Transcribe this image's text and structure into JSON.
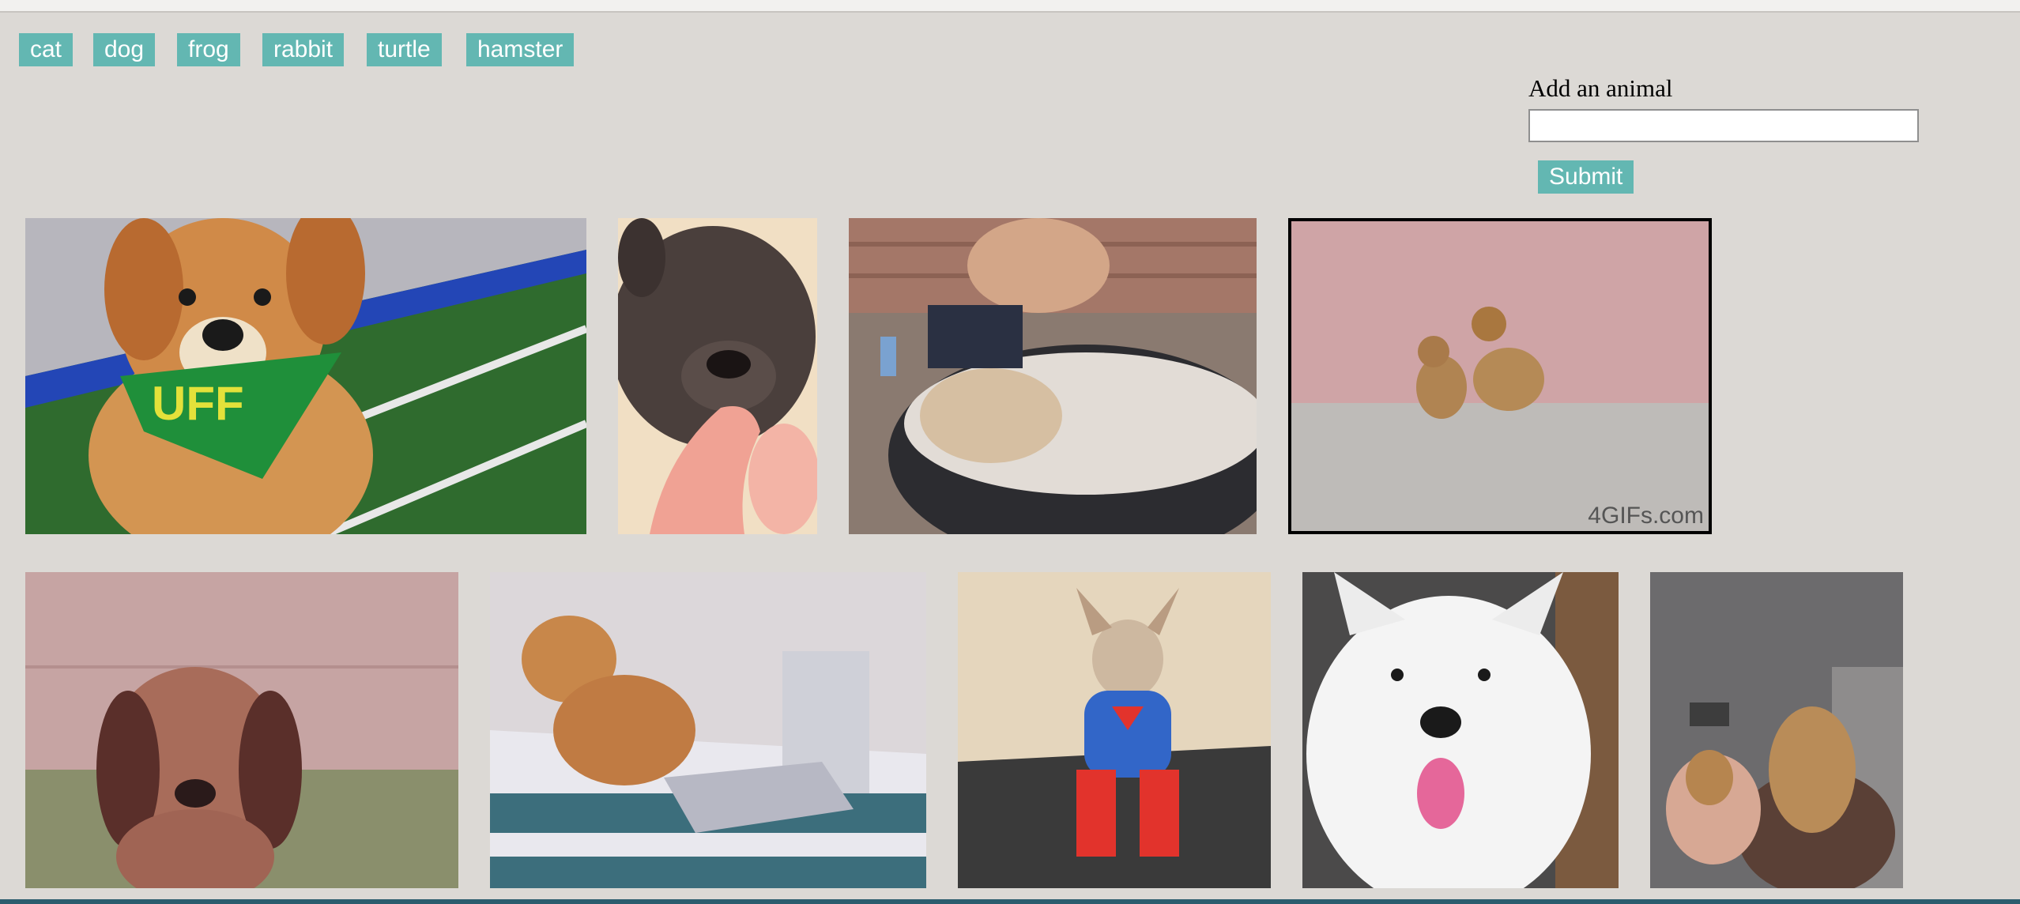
{
  "animals": {
    "buttons": [
      "cat",
      "dog",
      "frog",
      "rabbit",
      "turtle",
      "hamster"
    ]
  },
  "form": {
    "label": "Add an animal",
    "input_value": "",
    "submit_label": "Submit"
  },
  "gifs": {
    "watermark": "4GIFs.com"
  }
}
